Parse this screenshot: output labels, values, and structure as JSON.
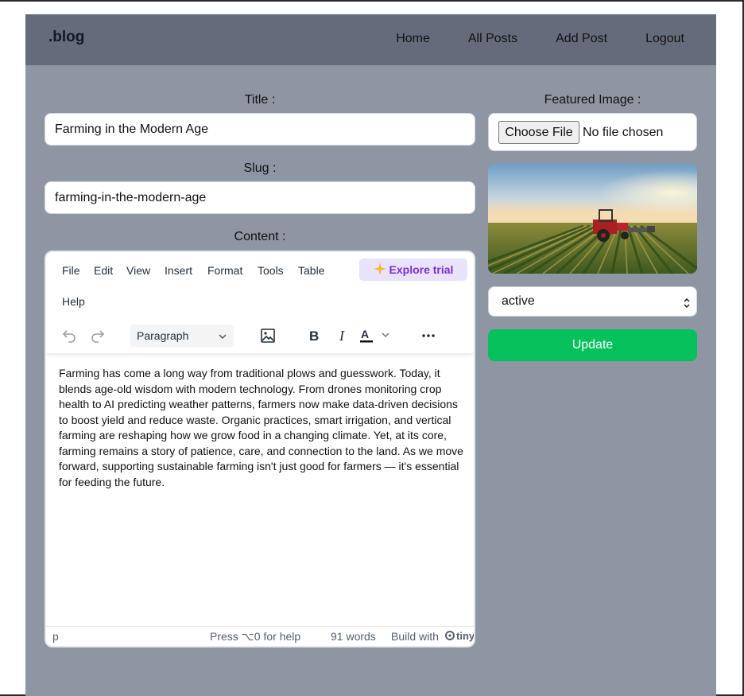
{
  "brand": {
    "logo": ".blog"
  },
  "nav": {
    "home": "Home",
    "all_posts": "All Posts",
    "add_post": "Add Post",
    "logout": "Logout"
  },
  "form": {
    "title_label": "Title :",
    "title_value": "Farming in the Modern Age",
    "slug_label": "Slug :",
    "slug_value": "farming-in-the-modern-age",
    "content_label": "Content :"
  },
  "editor": {
    "menu": {
      "file": "File",
      "edit": "Edit",
      "view": "View",
      "insert": "Insert",
      "format": "Format",
      "tools": "Tools",
      "table": "Table",
      "help": "Help"
    },
    "explore_trial": "Explore trial",
    "block_format": "Paragraph",
    "body": "Farming has come a long way from traditional plows and guesswork. Today, it blends age-old wisdom with modern technology. From drones monitoring crop health to AI predicting weather patterns, farmers now make data-driven decisions to boost yield and reduce waste. Organic practices, smart irrigation, and vertical farming are reshaping how we grow food in a changing climate. Yet, at its core, farming remains a story of patience, care, and connection to the land. As we move forward, supporting sustainable farming isn't just good for farmers — it's essential for feeding the future.",
    "status_path": "p",
    "help_hint": "Press ⌥0 for help",
    "word_count": "91 words",
    "build_with": "Build with",
    "brand_mark": "tiny"
  },
  "sidebar": {
    "featured_label": "Featured Image :",
    "choose_file": "Choose File",
    "no_file": "No file chosen",
    "status_value": "active",
    "update_label": "Update"
  },
  "colors": {
    "nav_bg": "#646c7b",
    "page_bg": "#8e96a4",
    "update_btn": "#04c15c",
    "trial_bg": "#e9e2fb",
    "trial_text": "#7b2fd1"
  }
}
